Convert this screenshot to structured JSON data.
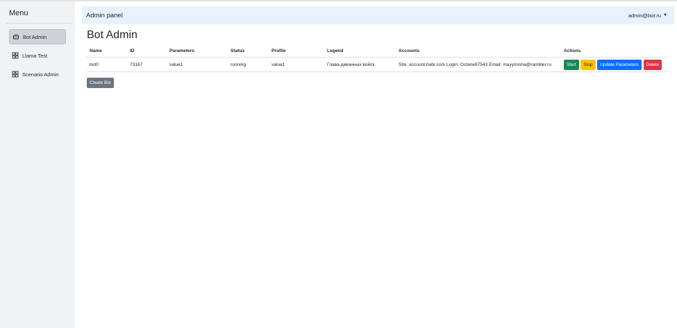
{
  "sidebar": {
    "title": "Menu",
    "items": [
      {
        "label": "Bot Admin",
        "icon": "robot-icon",
        "active": true
      },
      {
        "label": "Llama Test",
        "icon": "grid-icon",
        "active": false
      },
      {
        "label": "Scenario Admin",
        "icon": "grid-icon",
        "active": false
      }
    ]
  },
  "navbar": {
    "brand": "Admin panel",
    "user": "admin@bot.ru"
  },
  "main": {
    "title": "Bot Admin",
    "create_button": "Create Bot"
  },
  "table": {
    "headers": [
      "Name",
      "ID",
      "Parameters",
      "Status",
      "Profile",
      "Legend",
      "Accounts",
      "Actions"
    ],
    "rows": [
      {
        "name": "bot0",
        "id": "73167",
        "parameters": "value1",
        "status": "running",
        "profile": "value1",
        "legend": "Глава диванных войск",
        "accounts": "Site: account.habr.com Login: Octane87543 Email: mayymisha@rambler.ru",
        "actions": {
          "start": "Start",
          "stop": "Stop",
          "update": "Update Parameters",
          "delete": "Delete"
        }
      }
    ]
  },
  "colors": {
    "start": "#198754",
    "stop": "#ffc107",
    "update": "#0d6efd",
    "delete": "#dc3545",
    "secondary": "#6c757d",
    "navbar_bg": "#e8f2fc",
    "sidebar_bg": "#f1f2f3"
  }
}
